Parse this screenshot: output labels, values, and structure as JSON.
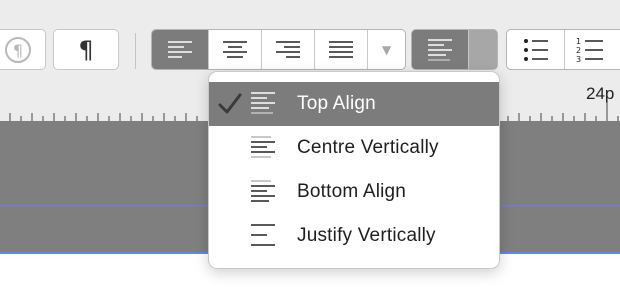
{
  "toolbar": {
    "invisibles_icon": "pilcrow-icon",
    "pilcrow_glyph": "¶",
    "alignment_buttons": [
      "align-left-icon",
      "align-center-icon",
      "align-right-icon",
      "align-justify-icon"
    ],
    "dropdown_arrow": "▼",
    "vertical_align_selected": "top-align-icon",
    "list_buttons": [
      "bulleted-list-icon",
      "numbered-list-icon"
    ]
  },
  "ruler": {
    "label": "24p"
  },
  "menu": {
    "items": [
      {
        "label": "Top Align",
        "icon": "top-align-icon",
        "checked": true,
        "highlighted": true
      },
      {
        "label": "Centre Vertically",
        "icon": "centre-vertically-icon",
        "checked": false,
        "highlighted": false
      },
      {
        "label": "Bottom Align",
        "icon": "bottom-align-icon",
        "checked": false,
        "highlighted": false
      },
      {
        "label": "Justify Vertically",
        "icon": "justify-vertically-icon",
        "checked": false,
        "highlighted": false
      }
    ]
  },
  "colors": {
    "highlight": "#7c7c7c",
    "guide": "#6b7cf2",
    "page_edge": "#5f86f5"
  }
}
